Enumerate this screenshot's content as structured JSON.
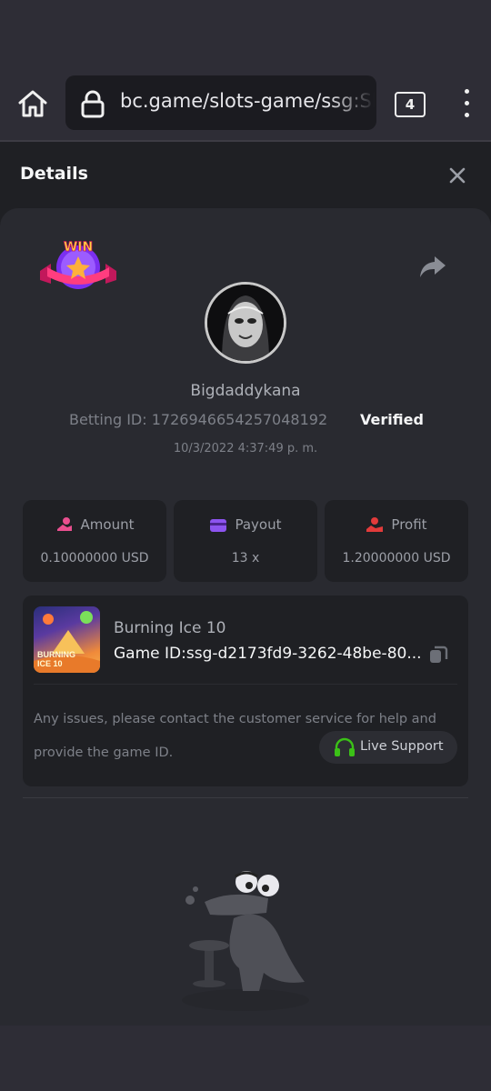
{
  "browser": {
    "url": "bc.game/slots-game/ssg:Slots",
    "tab_count": "4"
  },
  "panel": {
    "title": "Details"
  },
  "bet": {
    "username": "Bigdaddykana",
    "betting_id_label": "Betting ID:",
    "betting_id": "1726946654257048192",
    "verified_label": "Verified",
    "datetime": "10/3/2022 4:37:49 p. m.",
    "badge_text": "WIN"
  },
  "stats": [
    {
      "label": "Amount",
      "value": "0.10000000 USD",
      "icon": "money-hand-icon",
      "color": "#e94f8f"
    },
    {
      "label": "Payout",
      "value": "13 x",
      "icon": "card-icon",
      "color": "#8d54f0"
    },
    {
      "label": "Profit",
      "value": "1.20000000 USD",
      "icon": "profit-hand-icon",
      "color": "#e23b3b"
    }
  ],
  "game": {
    "name": "Burning Ice 10",
    "thumb_text": "BURNING ICE 10",
    "id_label": "Game ID:",
    "id": "ssg-d2173fd9-3262-48be-80...",
    "help_text": "Any issues, please contact the customer service for help and provide the game ID.",
    "support_label": "Live Support"
  },
  "colors": {
    "accent_green": "#3bc117",
    "background": "#1f2024",
    "card": "#292a30"
  }
}
